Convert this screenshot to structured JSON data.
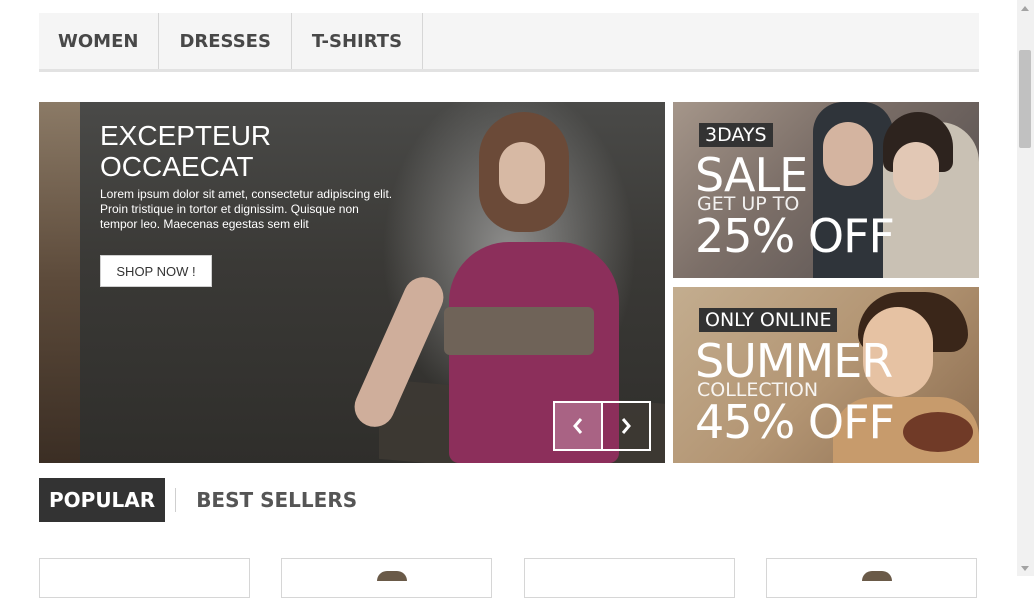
{
  "menu": {
    "items": [
      {
        "label": "WOMEN"
      },
      {
        "label": "DRESSES"
      },
      {
        "label": "T-SHIRTS"
      }
    ]
  },
  "slider": {
    "title_line1": "EXCEPTEUR",
    "title_line2": "OCCAECAT",
    "text_line1": "Lorem ipsum dolor sit amet, consectetur adipiscing elit.",
    "text_line2": "Proin tristique in tortor et dignissim. Quisque non",
    "text_line3": "tempor leo. Maecenas egestas sem elit",
    "button_label": "SHOP NOW !",
    "prev_icon": "chevron-left-icon",
    "next_icon": "chevron-right-icon"
  },
  "banner_sale": {
    "tag": "3DAYS",
    "headline": "SALE",
    "subline": "GET UP TO",
    "offer": "25% OFF"
  },
  "banner_summer": {
    "tag": "ONLY ONLINE",
    "headline": "SUMMER",
    "subline": "COLLECTION",
    "offer": "45% OFF"
  },
  "tabs": {
    "popular": "POPULAR",
    "best_sellers": "BEST SELLERS"
  },
  "colors": {
    "menu_bg": "#f5f5f5",
    "tab_active_bg": "#333333",
    "tag_bg": "#333333"
  }
}
